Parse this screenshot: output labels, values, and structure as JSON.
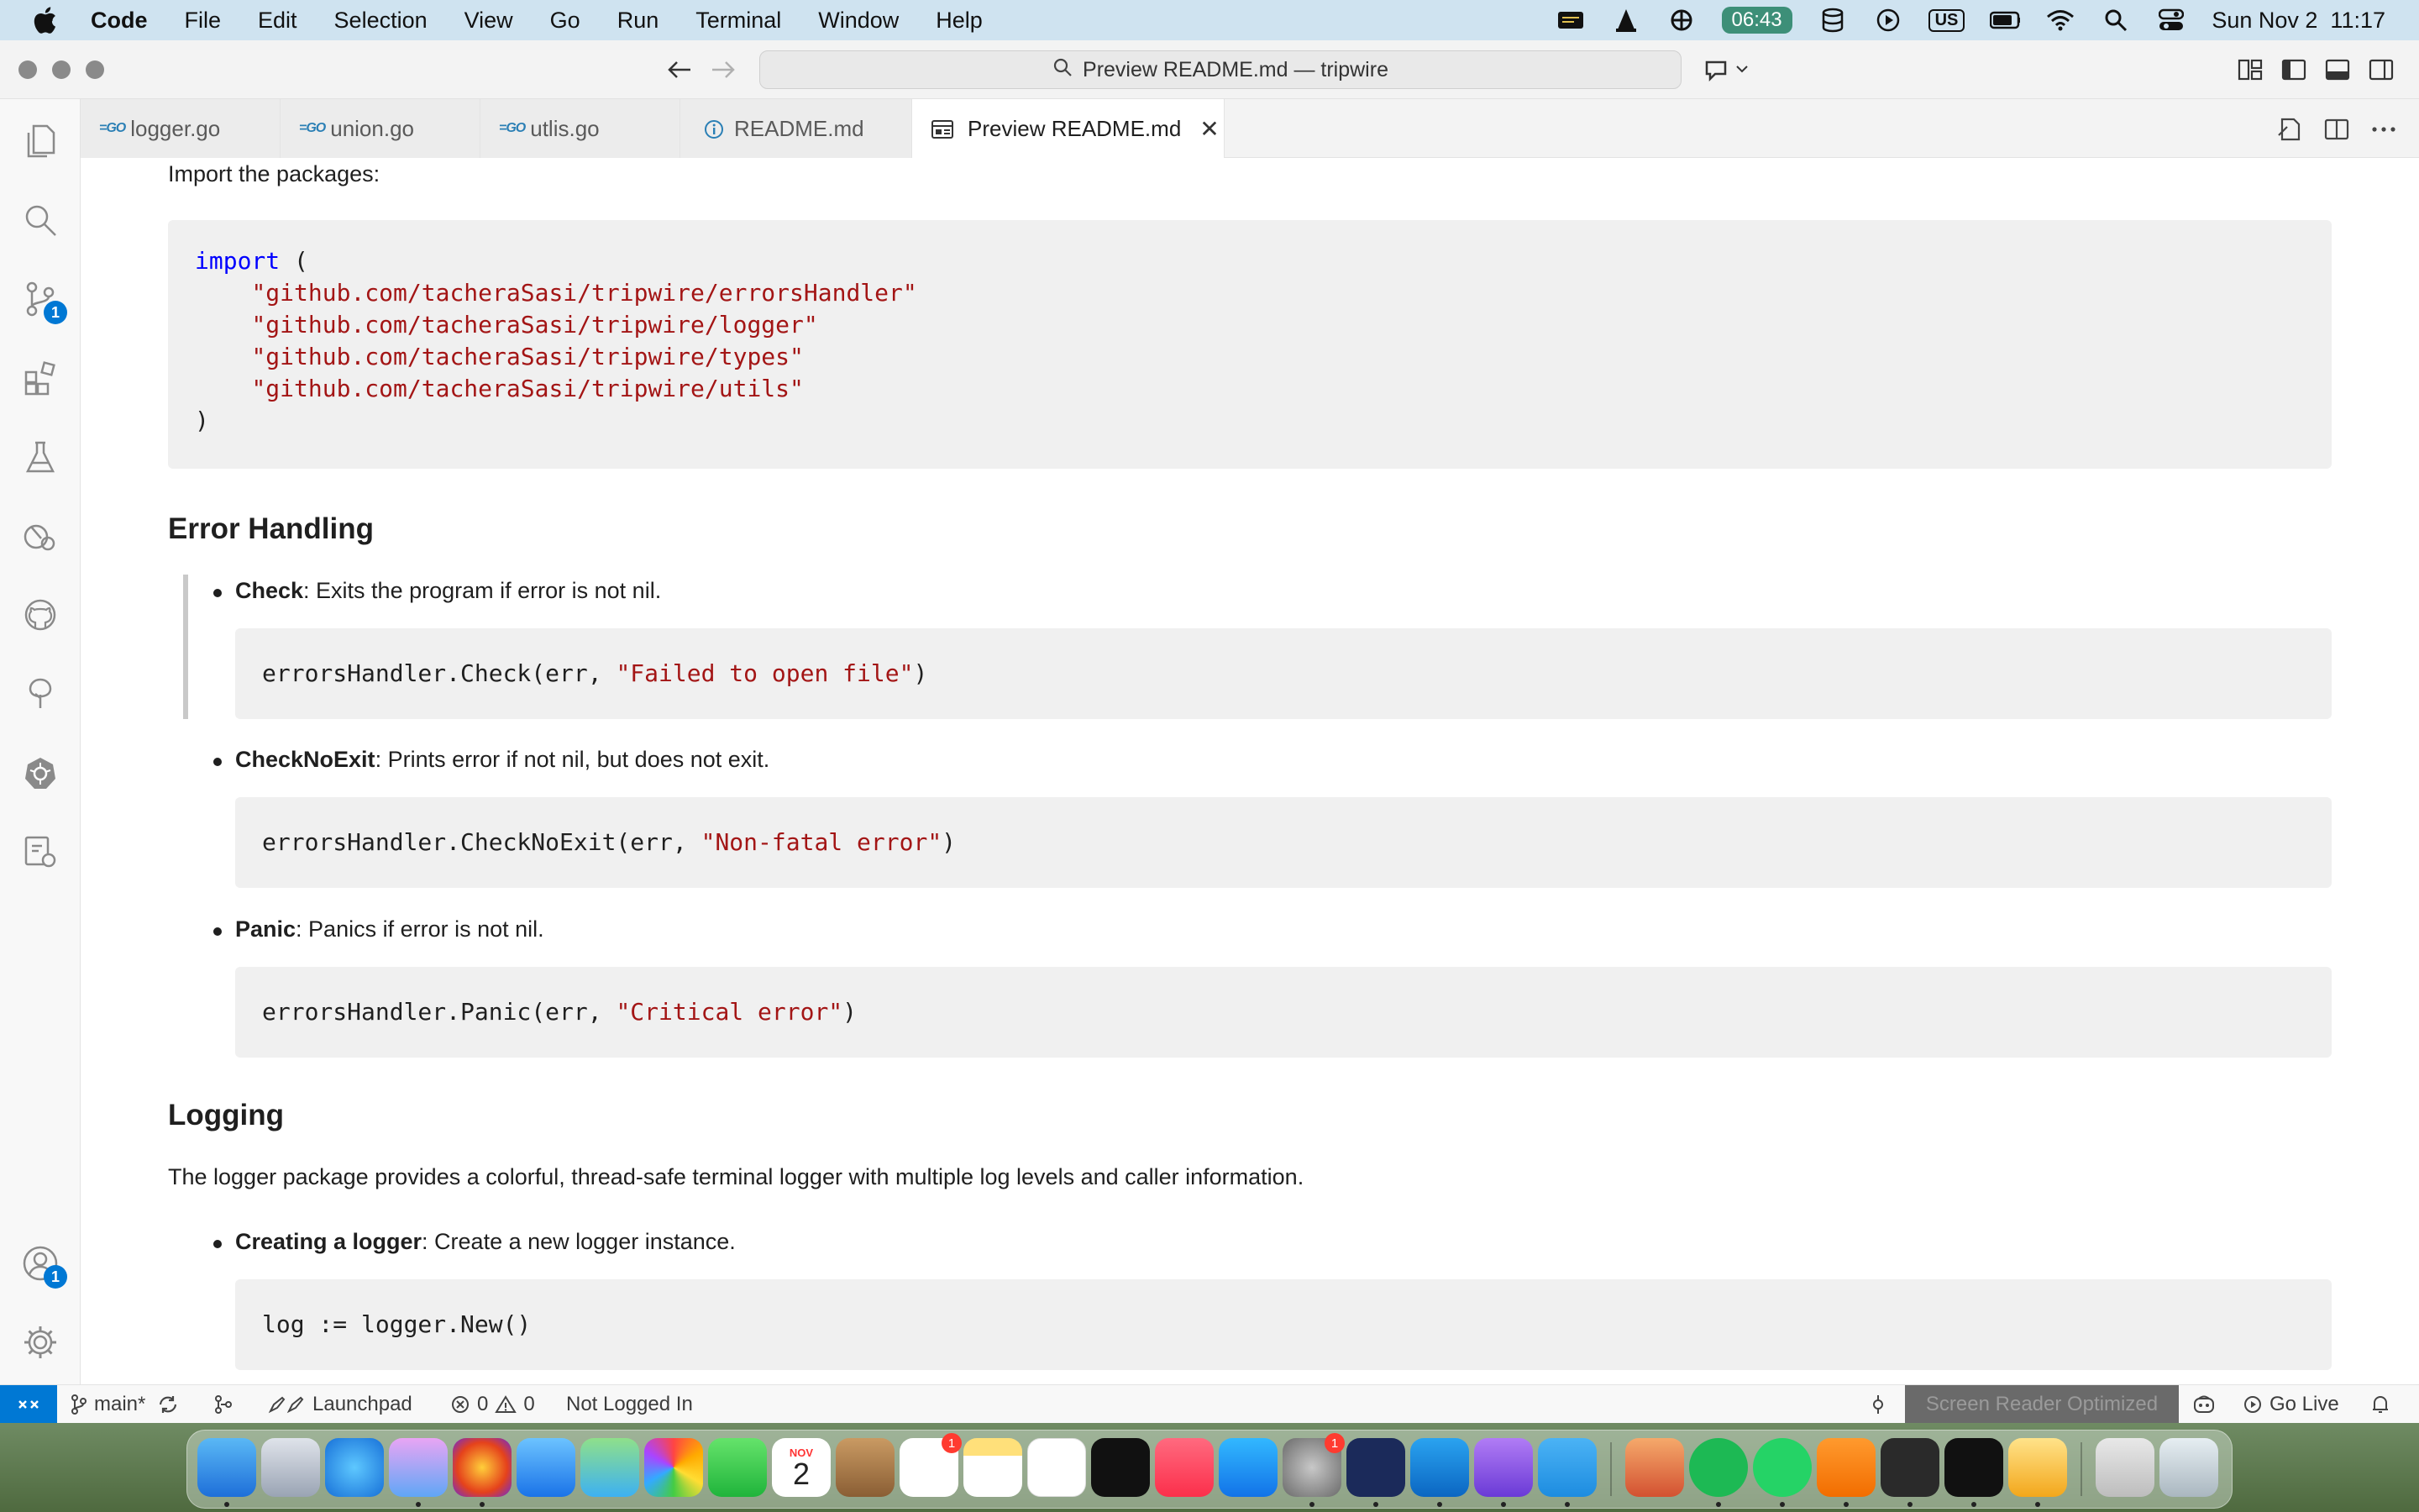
{
  "menubar": {
    "app_name": "Code",
    "items": [
      "File",
      "Edit",
      "Selection",
      "View",
      "Go",
      "Run",
      "Terminal",
      "Window",
      "Help"
    ],
    "timer": "06:43",
    "input_source": "US",
    "datetime": "Sun Nov 2  11:17"
  },
  "titlebar": {
    "command_center": "Preview README.md — tripwire"
  },
  "activity": {
    "source_control_badge": "1",
    "accounts_badge": "1"
  },
  "tabs": [
    {
      "label": "logger.go",
      "icon": "go-file-icon"
    },
    {
      "label": "union.go",
      "icon": "go-file-icon"
    },
    {
      "label": "utlis.go",
      "icon": "go-file-icon"
    },
    {
      "label": "README.md",
      "icon": "info-icon"
    },
    {
      "label": "Preview README.md",
      "icon": "preview-icon",
      "active": true
    }
  ],
  "content": {
    "import_intro": "Import the packages:",
    "import_code": {
      "keyword": "import",
      "open": " (",
      "packages": [
        "\"github.com/tacheraSasi/tripwire/errorsHandler\"",
        "\"github.com/tacheraSasi/tripwire/logger\"",
        "\"github.com/tacheraSasi/tripwire/types\"",
        "\"github.com/tacheraSasi/tripwire/utils\""
      ],
      "close": ")"
    },
    "error_heading": "Error Handling",
    "error_items": [
      {
        "term": "Check",
        "desc": ": Exits the program if error is not nil.",
        "code_prefix": "errorsHandler.Check(err, ",
        "code_str": "\"Failed to open file\"",
        "code_suffix": ")"
      },
      {
        "term": "CheckNoExit",
        "desc": ": Prints error if not nil, but does not exit.",
        "code_prefix": "errorsHandler.CheckNoExit(err, ",
        "code_str": "\"Non-fatal error\"",
        "code_suffix": ")"
      },
      {
        "term": "Panic",
        "desc": ": Panics if error is not nil.",
        "code_prefix": "errorsHandler.Panic(err, ",
        "code_str": "\"Critical error\"",
        "code_suffix": ")"
      }
    ],
    "logging_heading": "Logging",
    "logging_intro": "The logger package provides a colorful, thread-safe terminal logger with multiple log levels and caller information.",
    "logging_items": [
      {
        "term": "Creating a logger",
        "desc": ": Create a new logger instance.",
        "code": "log := logger.New()"
      }
    ]
  },
  "statusbar": {
    "branch": "main*",
    "launchpad": "Launchpad",
    "errors": "0",
    "warnings": "0",
    "login": "Not Logged In",
    "screen_reader": "Screen Reader Optimized",
    "go_live": "Go Live"
  },
  "dock": {
    "calendar_month": "NOV",
    "calendar_day": "2",
    "reminders_badge": "1",
    "settings_badge": "1"
  }
}
